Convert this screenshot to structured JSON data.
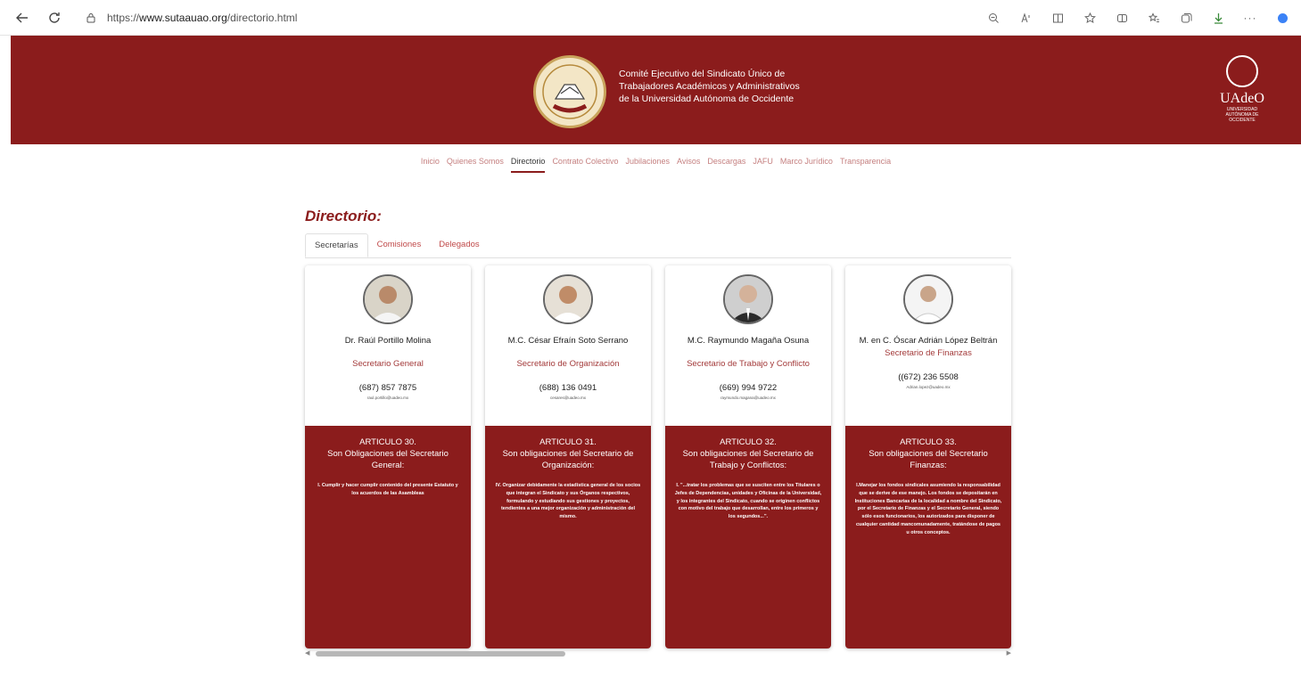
{
  "browser": {
    "url_prefix": "https://",
    "url_host": "www.sutaauao.org",
    "url_path": "/directorio.html"
  },
  "header": {
    "title_line1": "Comité Ejecutivo del Sindicato Único de",
    "title_line2": "Trabajadores Académicos y Administrativos",
    "title_line3": "de la Universidad Autónoma de Occidente",
    "uni_name": "UAdeO",
    "uni_sub1": "UNIVERSIDAD",
    "uni_sub2": "AUTÓNOMA DE",
    "uni_sub3": "OCCIDENTE",
    "brand_color": "#8b1c1c"
  },
  "nav": [
    "Inicio",
    "Quienes Somos",
    "Directorio",
    "Contrato Colectivo",
    "Jubilaciones",
    "Avisos",
    "Descargas",
    "JAFU",
    "Marco Jurídico",
    "Transparencia"
  ],
  "page_title": "Directorio:",
  "tabs": [
    "Secretarías",
    "Comisiones",
    "Delegados"
  ],
  "cards": [
    {
      "name": "Dr. Raúl Portillo Molina",
      "role": "Secretario General",
      "phone": "(687) 857 7875",
      "email": "raul.portillo@uadeo.mx",
      "article": "ARTICULO 30.",
      "article_sub": "Son Obligaciones del Secretario General:",
      "body": "I. Cumplir y hacer cumplir contenido del presente Estatuto y los acuerdos de las Asambleas"
    },
    {
      "name": "M.C. César Efraín Soto Serrano",
      "role": "Secretario de Organización",
      "phone": "(688) 136 0491",
      "email": "cesares@uadeo.mx",
      "article": "ARTICULO 31.",
      "article_sub": "Son obligaciones del Secretario de Organización:",
      "body": "IV. Organizar debidamente la estadística general de los socios que integran el Sindicato y sus Órganos respectivos, formulando y estudiando sus gestiones y proyectos, tendientes a una mejor organización y administración del mismo."
    },
    {
      "name": "M.C. Raymundo Magaña Osuna",
      "role": "Secretario de Trabajo y Conflicto",
      "phone": "(669) 994 9722",
      "email": "raymundo.magana@uadeo.mx",
      "article": "ARTICULO 32.",
      "article_sub": "Son obligaciones del Secretario de Trabajo y Conflictos:",
      "body": "I. \"...tratar los problemas que se susciten entre los Titulares o Jefes de Dependencias, unidades y Oficinas de la Universidad, y los integrantes del Sindicato, cuando se originen conflictos con motivo del trabajo que desarrollan, entre los primeros y los segundos...\"."
    },
    {
      "name": "M. en C. Óscar Adrián López Beltrán",
      "role": "Secretario de Finanzas",
      "phone": "((672) 236 5508",
      "email": "Adrian.lopez@uadeo.mx",
      "article": "ARTICULO 33.",
      "article_sub": "Son obligaciones del Secretario Finanzas:",
      "body": "I.Manejar los fondos sindicales asumiendo la responsabilidad que se derive de ese manejo. Los fondos se depositarán en Instituciones Bancarias de la localidad a nombre del Sindicato, por el Secretario de Finanzas y el Secretario General, siendo sólo esos funcionarios, los autorizados para disponer de cualquier cantidad mancomunadamente, tratándose de pagos u otros conceptos."
    }
  ]
}
